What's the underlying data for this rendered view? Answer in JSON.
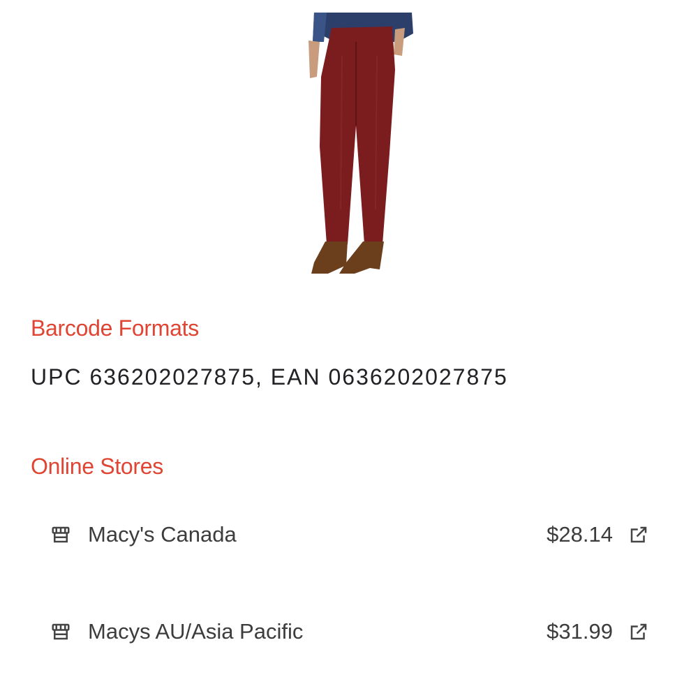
{
  "colors": {
    "accent": "#e04433",
    "text_primary": "#202124",
    "text_secondary": "#3c3c3c",
    "icon": "#444444",
    "pants": "#7b1c1f",
    "boots": "#6b3e1c",
    "shirt": "#2c3f6b"
  },
  "product": {
    "image_icon": "product-photo-red-pants"
  },
  "barcode_section": {
    "title": "Barcode Formats",
    "value": "UPC 636202027875, EAN 0636202027875"
  },
  "stores_section": {
    "title": "Online Stores",
    "stores": [
      {
        "name": "Macy's Canada",
        "price": "$28.14",
        "icon": "store-icon",
        "action_icon": "open-in-new-icon"
      },
      {
        "name": "Macys AU/Asia Pacific",
        "price": "$31.99",
        "icon": "store-icon",
        "action_icon": "open-in-new-icon"
      }
    ]
  }
}
